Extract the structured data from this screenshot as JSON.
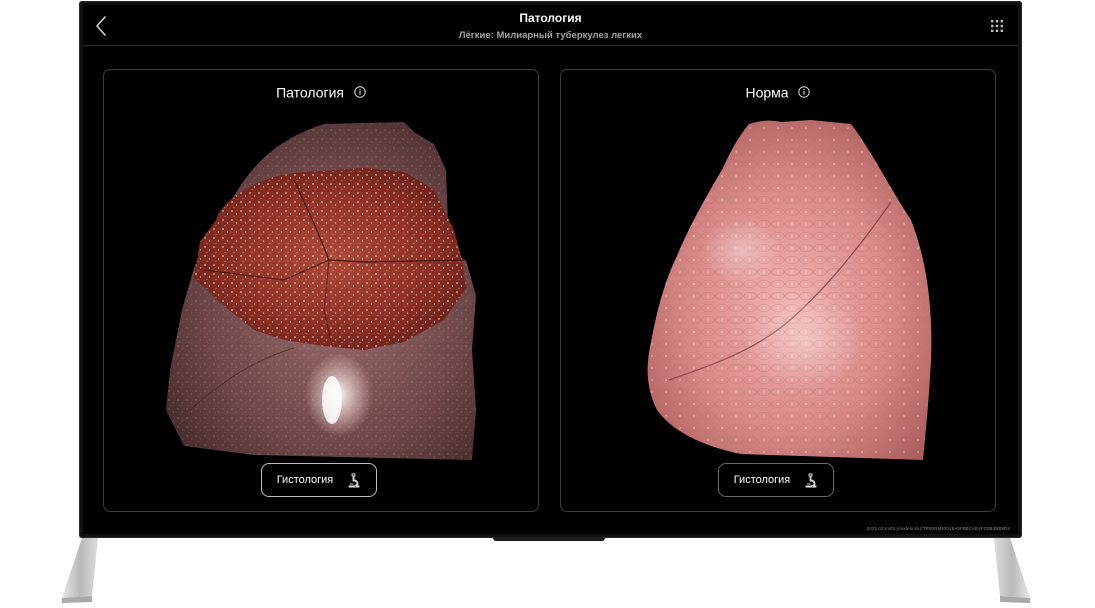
{
  "header": {
    "title": "Патология",
    "subtitle": "Лёгкие: Милиарный туберкулез легких"
  },
  "panels": [
    {
      "heading": "Патология",
      "button_label": "Гистология",
      "image": "lung-pathology-cut-section"
    },
    {
      "heading": "Норма",
      "button_label": "Гистология",
      "image": "lung-normal"
    }
  ],
  "footer": {
    "build_code": "2021.03.mi03 (models 81)/TR00RM92019A5F8BCAE4FC0B3BB8D4"
  },
  "icons": {
    "back": "chevron-left-icon",
    "menu": "grid-menu-icon",
    "info": "info-icon",
    "histology": "microscope-icon"
  },
  "colors": {
    "screen_bg": "#000000",
    "text_primary": "#ffffff",
    "text_secondary": "#a3a3a3",
    "panel_border": "#3c3c3c",
    "stand": "#c8c8c8"
  }
}
